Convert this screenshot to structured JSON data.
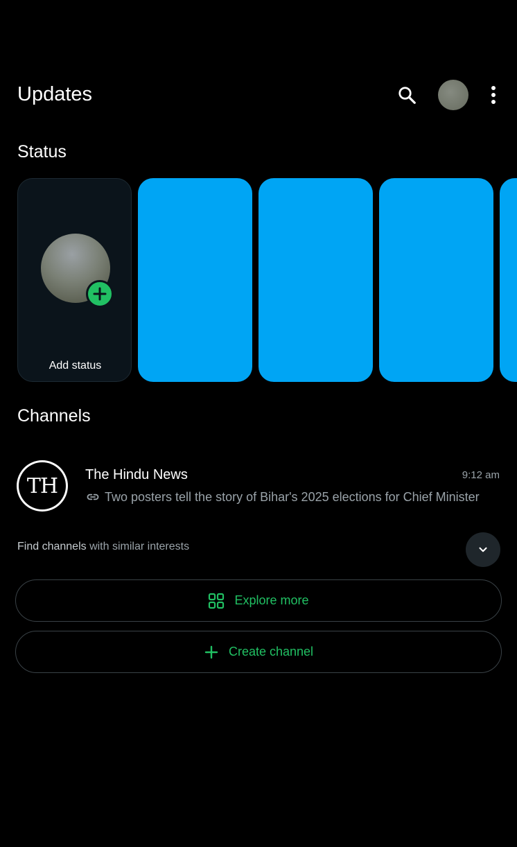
{
  "header": {
    "title": "Updates",
    "search_icon": "search-icon",
    "menu_icon": "more-vert-icon"
  },
  "status": {
    "section_title": "Status",
    "add_status_label": "Add status",
    "add_icon": "plus-circle-icon",
    "story_color": "#00a5f4",
    "story_count_visible": 4
  },
  "channels": {
    "section_title": "Channels",
    "items": [
      {
        "avatar_text": "TH",
        "name": "The Hindu News",
        "time": "9:12 am",
        "preview": "Two posters tell the story of Bihar's 2025 elections for Chief Minister",
        "preview_icon": "link-icon"
      }
    ],
    "find_prefix": "Find channels",
    "find_suffix": " with similar interests",
    "expand_icon": "chevron-down-icon"
  },
  "actions": {
    "explore_label": "Explore more",
    "explore_icon": "grid-icon",
    "create_label": "Create channel",
    "create_icon": "plus-icon"
  },
  "colors": {
    "accent": "#21c063",
    "background": "#000000",
    "secondary_text": "#9aa3a9"
  }
}
